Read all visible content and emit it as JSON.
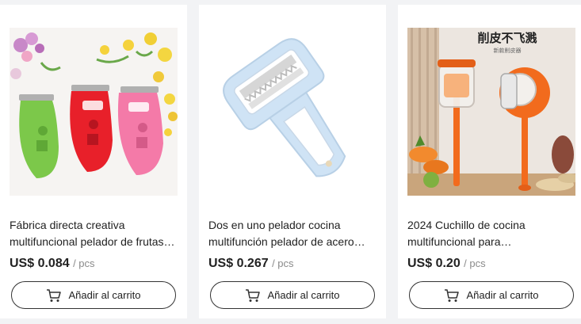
{
  "products": [
    {
      "title": "Fábrica directa creativa multifuncional pelador de frutas…",
      "price": "US$ 0.084",
      "unit": "/ pcs",
      "button_label": "Añadir al carrito",
      "image_icon": "three-peelers-image"
    },
    {
      "title": "Dos en uno pelador cocina multifunción pelador de acero…",
      "price": "US$ 0.267",
      "unit": "/ pcs",
      "button_label": "Añadir al carrito",
      "image_icon": "blue-peeler-image"
    },
    {
      "title": "2024 Cuchillo de cocina multifuncional para…",
      "price": "US$ 0.20",
      "unit": "/ pcs",
      "button_label": "Añadir al carrito",
      "image_icon": "orange-peeler-image",
      "image_caption": "削皮不飞溅",
      "image_subcaption": "新款削皮器"
    }
  ],
  "colors": {
    "card_bg": "#ffffff",
    "page_bg": "#f2f3f5",
    "text": "#222222",
    "unit_text": "#8a8a8a",
    "peeler_green": "#7cc84a",
    "peeler_red": "#e8202a",
    "peeler_pink": "#f47aa8",
    "peeler_blue": "#cfe3f5",
    "peeler_orange": "#f26b1d"
  }
}
